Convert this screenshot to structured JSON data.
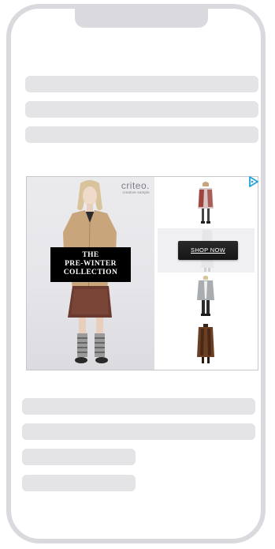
{
  "ad": {
    "brand_logo": "criteo.",
    "brand_sub": "creative sample",
    "promo_lines": [
      "THE",
      "PRE-WINTER",
      "COLLECTION"
    ],
    "cta_label": "SHOP NOW",
    "icons": [
      "adchoices-icon"
    ],
    "colors": {
      "accent_icon": "#1ea2d8",
      "coat": "#c9a57c",
      "skirt": "#6b3a30",
      "button": "#1f1f1f"
    }
  }
}
